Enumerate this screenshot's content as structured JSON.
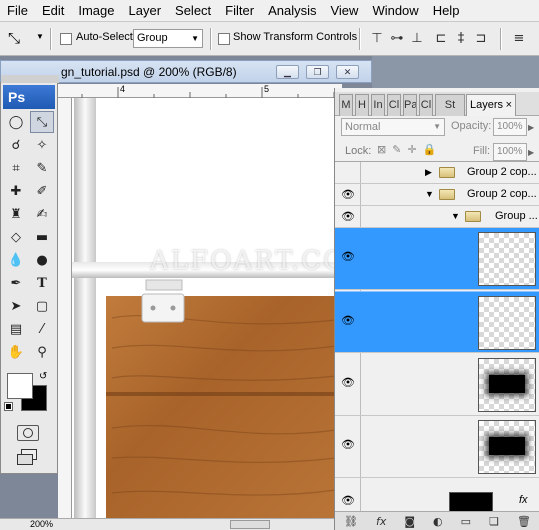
{
  "menubar": {
    "items": [
      "File",
      "Edit",
      "Image",
      "Layer",
      "Select",
      "Filter",
      "Analysis",
      "View",
      "Window",
      "Help"
    ]
  },
  "options": {
    "auto_select_label": "Auto-Select:",
    "auto_select_value": "Group",
    "show_transform_label": "Show Transform Controls"
  },
  "document": {
    "title": "gn_tutorial.psd @ 200% (RGB/8)",
    "ruler_marks": [
      "4",
      "5"
    ],
    "zoom": "200%",
    "watermark": "ALFOART.COM"
  },
  "toolbox": {
    "logo": "Ps"
  },
  "layers_panel": {
    "tabs": [
      "M",
      "H",
      "In",
      "Cl",
      "Pa",
      "Cl",
      "St",
      "Layers"
    ],
    "close_glyph": "×",
    "blend_mode": "Normal",
    "opacity_label": "Opacity:",
    "opacity_value": "100%",
    "lock_label": "Lock:",
    "fill_label": "Fill:",
    "fill_value": "100%",
    "groups": [
      {
        "name": "Group 2 cop..."
      },
      {
        "name": "Group 2 cop..."
      },
      {
        "name": "Group ..."
      }
    ],
    "footer_icons": [
      "link-icon",
      "fx-icon",
      "mask-icon",
      "adjustment-icon",
      "folder-icon",
      "new-layer-icon",
      "trash-icon"
    ],
    "fx_badge": "fx"
  },
  "colors": {
    "selection_blue": "#3399ff",
    "wood": "#b06a2c"
  }
}
